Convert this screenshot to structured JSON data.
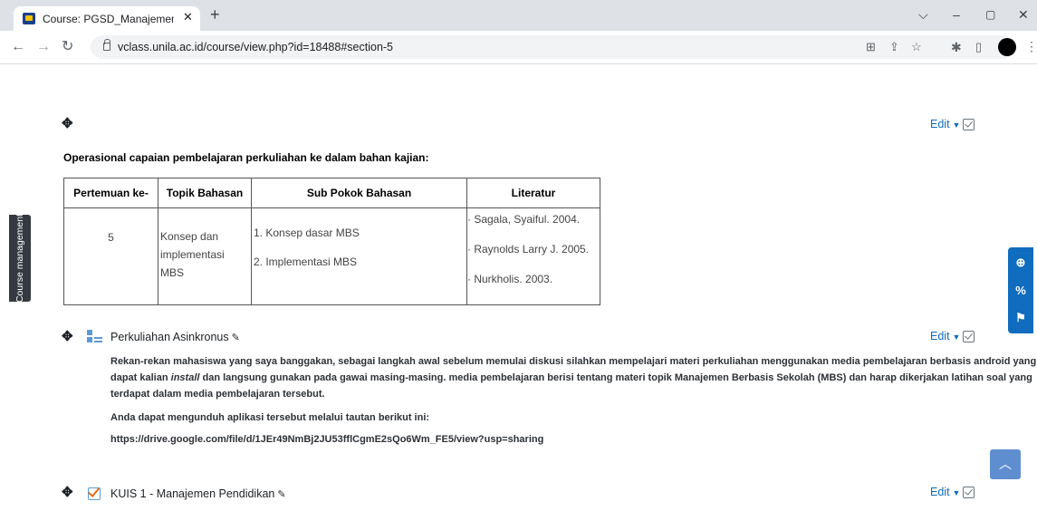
{
  "browser": {
    "tab_title": "Course: PGSD_Manajemen Pendidikan",
    "tab_close": "✕",
    "new_tab": "+",
    "url": "vclass.unila.ac.id/course/view.php?id=18488#section-5",
    "window_controls": [
      "⌵",
      "–",
      "▢",
      "✕"
    ]
  },
  "sidebar": {
    "label": "Course management"
  },
  "section": {
    "edit_label": "Edit",
    "heading": "Operasional capaian pembelajaran perkuliahan ke dalam bahan kajian:",
    "table": {
      "headers": [
        "Pertemuan ke-",
        "Topik Bahasan",
        "Sub Pokok Bahasan",
        "Literatur"
      ],
      "row": {
        "meeting": "5",
        "topic_line1": "Konsep dan",
        "topic_line2": "implementasi MBS",
        "sub_items": [
          "1.   Konsep dasar MBS",
          "2.   Implementasi MBS"
        ],
        "literature": [
          "· Sagala, Syaiful. 2004.",
          "· Raynolds Larry J. 2005.",
          "· Nurkholis. 2003."
        ]
      }
    }
  },
  "activities": [
    {
      "title": "Perkuliahan Asinkronus",
      "edit_label": "Edit",
      "paragraph_line1": "Rekan-rekan mahasiswa yang saya banggakan, sebagai langkah awal sebelum memulai diskusi silahkan mempelajari materi perkuliahan menggunakan media pembelajaran berbasis android yang",
      "paragraph_line2_a": "dapat kalian ",
      "paragraph_line2_italic": "install",
      "paragraph_line2_b": " dan langsung gunakan pada gawai masing-masing. media pembelajaran berisi tentang materi topik Manajemen Berbasis Sekolah (MBS) dan harap dikerjakan latihan soal yang",
      "paragraph_line3": "terdapat dalam media pembelajaran tersebut.",
      "download_text": "Anda dapat mengunduh aplikasi tersebut melalui tautan berikut ini:",
      "link": "https://drive.google.com/file/d/1JEr49NmBj2JU53fflCgmE2sQo6Wm_FE5/view?usp=sharing"
    },
    {
      "title": "KUIS 1 - Manajemen Pendidikan",
      "edit_label": "Edit"
    }
  ],
  "colors": {
    "accent": "#0f6cbf",
    "drawer": "#343a40",
    "back_to_top": "#5f8ed0"
  }
}
